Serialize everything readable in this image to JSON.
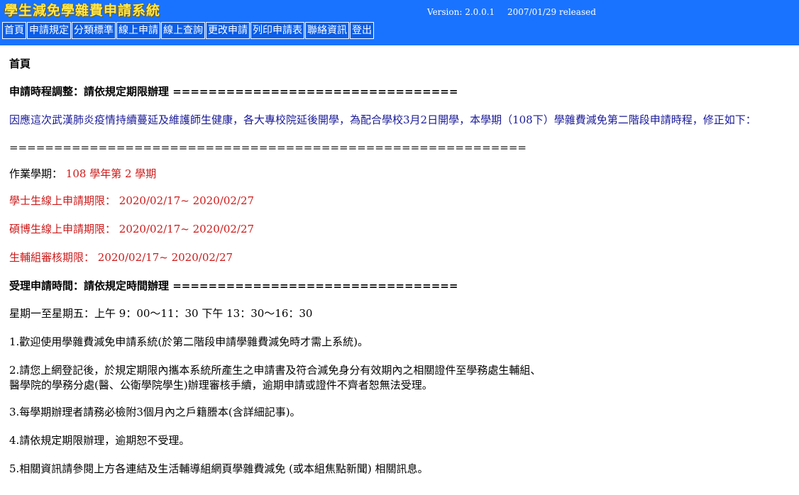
{
  "header": {
    "title": "學生減免學雜費申請系統",
    "version": "Version: 2.0.0.1",
    "released": "2007/01/29 released"
  },
  "nav": [
    {
      "label": "首頁"
    },
    {
      "label": "申請規定"
    },
    {
      "label": "分類標準"
    },
    {
      "label": "線上申請"
    },
    {
      "label": "線上查詢"
    },
    {
      "label": "更改申請"
    },
    {
      "label": "列印申請表"
    },
    {
      "label": "聯絡資訊"
    },
    {
      "label": "登出"
    }
  ],
  "content": {
    "page_title": "首頁",
    "schedule_heading": "申請時程調整：請依規定期限辦理 ================================",
    "notice": "因應這次武漢肺炎疫情持續蔓延及維護師生健康，各大專校院延後開學，為配合學校3月2日開學，本學期（108下）學雜費減免第二階段申請時程，修正如下：",
    "divider": "==========================================================",
    "term_label": "作業學期：",
    "term_value": "108 學年第 2 學期",
    "undergrad_label": "學士生線上申請期限：",
    "undergrad_value": "2020/02/17~ 2020/02/27",
    "grad_label": "碩博生線上申請期限：",
    "grad_value": "2020/02/17~ 2020/02/27",
    "review_label": "生輔組審核期限：",
    "review_value": "2020/02/17~ 2020/02/27",
    "hours_heading": "受理申請時間：請依規定時間辦理 ================================",
    "hours": "星期一至星期五：上午 9：00～11：30 下午 13：30～16：30",
    "item1": "1.歡迎使用學雜費減免申請系統(於第二階段申請學雜費減免時才需上系統)。",
    "item2a": "2.請您上網登記後，於規定期限內攜本系統所產生之申請書及符合減免身分有效期內之相關證件至學務處生輔組、",
    "item2b": "醫學院的學務分處(醫、公衛學院學生)辦理審核手續，逾期申請或證件不齊者恕無法受理。",
    "item3": "3.每學期辦理者請務必檢附3個月內之戶籍謄本(含詳細記事)。",
    "item4": "4.請依規定期限辦理，逾期恕不受理。",
    "item5": "5.相關資訊請參閱上方各連結及生活輔導組網頁學雜費減免 (或本組焦點新聞) 相關訊息。"
  }
}
